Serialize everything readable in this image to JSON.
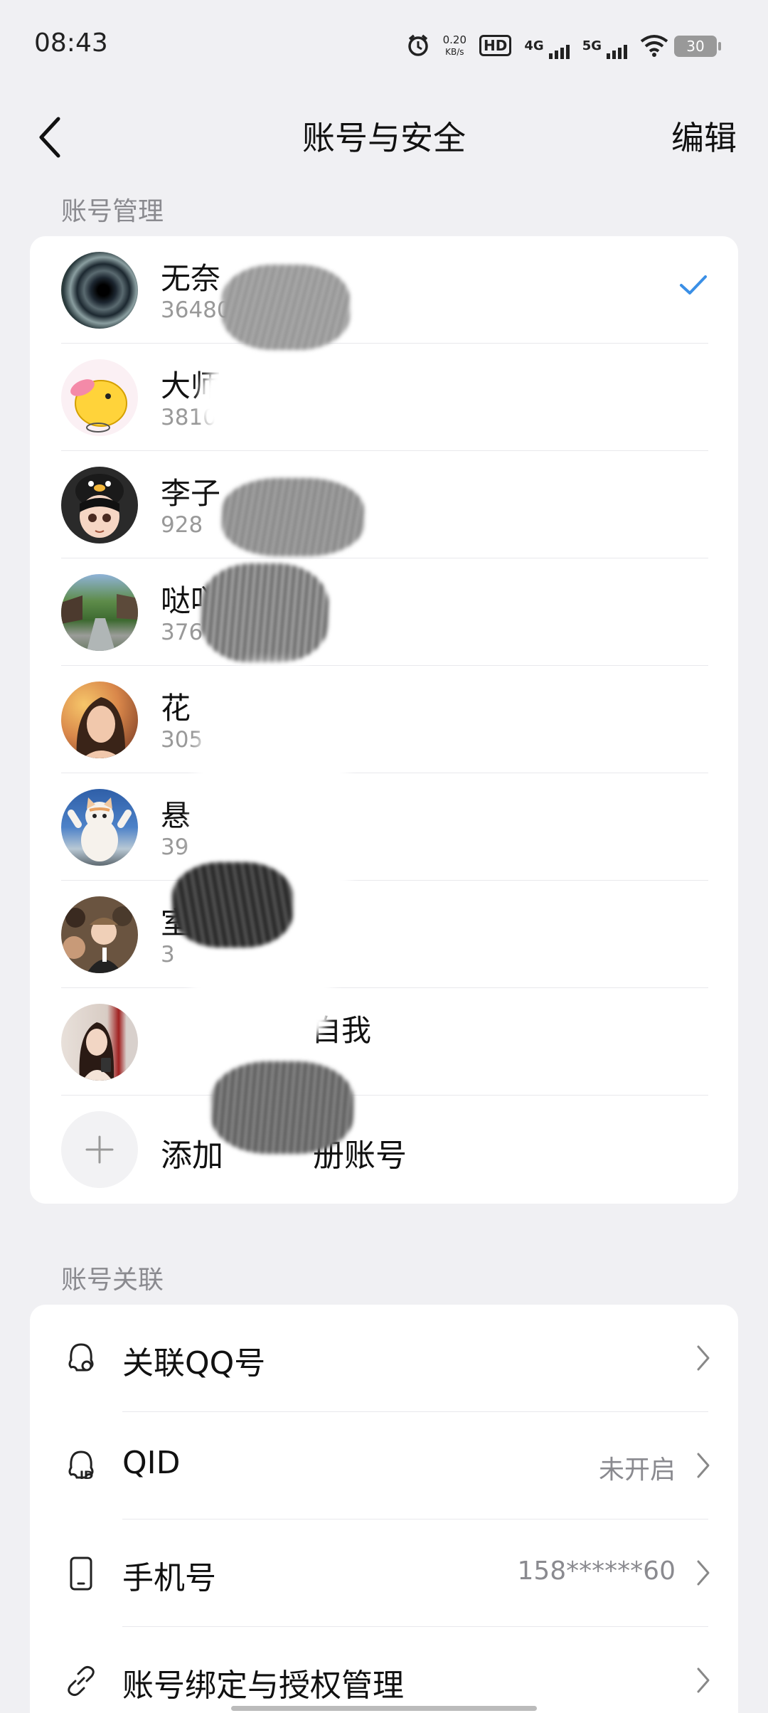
{
  "status_bar": {
    "time": "08:43",
    "net_speed_value": "0.20",
    "net_speed_unit": "KB/s",
    "hd_label": "HD",
    "net1": "4G",
    "net2": "5G",
    "battery": "30"
  },
  "nav": {
    "back_icon": "chevron-left-icon",
    "title": "账号与安全",
    "edit_label": "编辑"
  },
  "account_management": {
    "section_label": "账号管理",
    "accounts": [
      {
        "name": "无奈",
        "id": "36480",
        "selected": true,
        "avatar": "vortex-avatar"
      },
      {
        "name": "大师",
        "id": "3810",
        "selected": false,
        "avatar": "duck-avatar"
      },
      {
        "name": "李子",
        "id": "928",
        "selected": false,
        "avatar": "penguin-hat-avatar"
      },
      {
        "name": "哒吖",
        "id": "376",
        "selected": false,
        "avatar": "garden-avatar"
      },
      {
        "name": "花",
        "id": "305",
        "selected": false,
        "avatar": "portrait-avatar"
      },
      {
        "name": "悬",
        "id": "39",
        "selected": false,
        "avatar": "cat-avatar"
      },
      {
        "name": "室",
        "id": "3",
        "selected": false,
        "avatar": "crowd-avatar"
      },
      {
        "name": "自我",
        "id": "",
        "selected": false,
        "avatar": "girl-avatar"
      }
    ],
    "add_label": "添加",
    "add_label_tail": "册账号"
  },
  "account_links": {
    "section_label": "账号关联",
    "items": [
      {
        "label": "关联QQ号",
        "value": "",
        "icon": "qq-link-icon"
      },
      {
        "label": "QID",
        "value": "未开启",
        "icon": "qid-icon"
      },
      {
        "label": "手机号",
        "value": "158******60",
        "icon": "phone-icon"
      },
      {
        "label": "账号绑定与授权管理",
        "value": "",
        "icon": "link-icon"
      }
    ]
  },
  "colors": {
    "background": "#f0f0f3",
    "card": "#ffffff",
    "accent_check": "#3a8fe6",
    "secondary_text": "#8a8a8f"
  }
}
